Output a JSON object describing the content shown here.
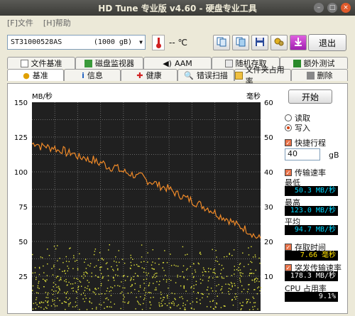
{
  "window": {
    "title": "HD Tune 专业版 v4.60 - 硬盘专业工具"
  },
  "menu": {
    "file": "[F]文件",
    "help": "[H]帮助"
  },
  "toolbar": {
    "drive": "ST31000528AS",
    "capacity": "(1000 gB)",
    "temp": "-- ℃",
    "exit": "退出"
  },
  "tabs_top": [
    "文件基准",
    "磁盘监视器",
    "AAM",
    "随机存取",
    "额外测试"
  ],
  "tabs_bottom": [
    "基准",
    "信息",
    "健康",
    "错误扫描",
    "文件夹占用率",
    "删除"
  ],
  "chart": {
    "left_unit": "MB/秒",
    "right_unit": "毫秒",
    "left_ticks": [
      "150",
      "125",
      "100",
      "75",
      "50",
      "25"
    ],
    "right_ticks": [
      "60",
      "50",
      "40",
      "30",
      "20",
      "10"
    ]
  },
  "chart_data": {
    "type": "line",
    "ylim_left": [
      0,
      150
    ],
    "ylim_right": [
      0,
      60
    ],
    "series": [
      {
        "name": "传输速率",
        "values": [
          120,
          121,
          118,
          119,
          117,
          118,
          115,
          116,
          113,
          114,
          112,
          110,
          111,
          108,
          109,
          106,
          107,
          104,
          103,
          104,
          101,
          100,
          99,
          98,
          96,
          97,
          94,
          93,
          92,
          90,
          89,
          88,
          86,
          84,
          83,
          81,
          80,
          78,
          77,
          75,
          74,
          72,
          70,
          68,
          67,
          65,
          63,
          61,
          60,
          58,
          56,
          53,
          52
        ]
      }
    ]
  },
  "side": {
    "start": "开始",
    "read": "读取",
    "write": "写入",
    "short_stroke": "快捷行程",
    "stroke_value": "40",
    "stroke_unit": "gB",
    "transfer_rate": "传输速率",
    "min_label": "最低",
    "min_value": "50.3 MB/秒",
    "max_label": "最高",
    "max_value": "123.0 MB/秒",
    "avg_label": "平均",
    "avg_value": "94.7 MB/秒",
    "access_time": "存取时间",
    "access_value": "7.66 毫秒",
    "burst_rate": "突发传输速率",
    "burst_value": "178.3 MB/秒",
    "cpu_label": "CPU 占用率",
    "cpu_value": "9.1%"
  },
  "colors": {
    "line": "#f08a28",
    "dots": "#e6e83c",
    "plot_bg": "#202020"
  }
}
